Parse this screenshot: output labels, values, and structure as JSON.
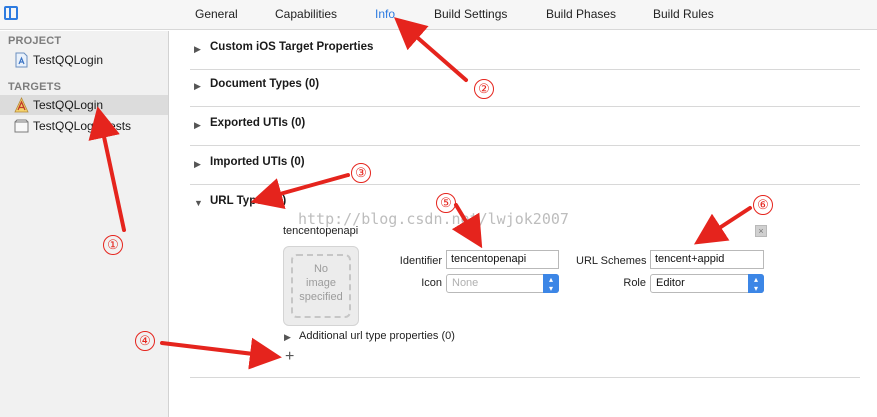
{
  "tabs": [
    {
      "label": "General"
    },
    {
      "label": "Capabilities"
    },
    {
      "label": "Info"
    },
    {
      "label": "Build Settings"
    },
    {
      "label": "Build Phases"
    },
    {
      "label": "Build Rules"
    }
  ],
  "active_tab": "Info",
  "sidebar": {
    "project_header": "PROJECT",
    "project_item": "TestQQLogin",
    "targets_header": "TARGETS",
    "targets": [
      {
        "label": "TestQQLogin",
        "selected": true
      },
      {
        "label": "TestQQLoginTests",
        "selected": false
      }
    ]
  },
  "sections": [
    {
      "title": "Custom iOS Target Properties",
      "expanded": false
    },
    {
      "title": "Document Types (0)",
      "expanded": false
    },
    {
      "title": "Exported UTIs (0)",
      "expanded": false
    },
    {
      "title": "Imported UTIs (0)",
      "expanded": false
    },
    {
      "title": "URL Types (1)",
      "expanded": true
    }
  ],
  "url_type": {
    "name": "tencentopenapi",
    "image_well": "No image specified",
    "identifier_label": "Identifier",
    "identifier_value": "tencentopenapi",
    "icon_label": "Icon",
    "icon_value": "None",
    "url_schemes_label": "URL Schemes",
    "url_schemes_value": "tencent+appid",
    "role_label": "Role",
    "role_value": "Editor",
    "additional": "Additional url type properties (0)",
    "add_symbol": "+"
  },
  "watermark": "http://blog.csdn.net/lwjok2007",
  "markers": [
    "①",
    "②",
    "③",
    "④",
    "⑤",
    "⑥"
  ],
  "colors": {
    "accent": "#2d7be0",
    "annotation": "#e5241d"
  },
  "icons": {
    "nav_toggle": "navigator-toggle-icon",
    "app_target": "app-target-icon",
    "test_target": "test-bundle-icon",
    "project": "project-file-icon"
  }
}
